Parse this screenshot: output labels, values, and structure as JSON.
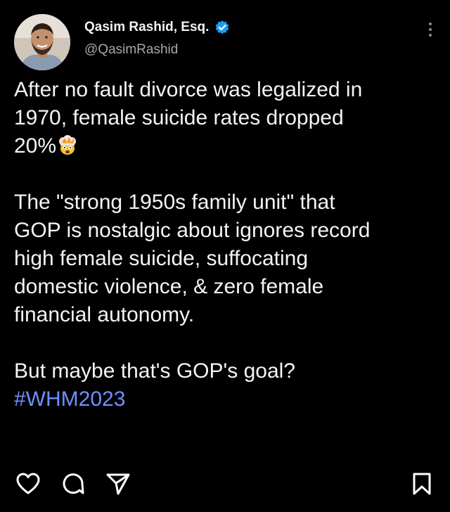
{
  "post": {
    "author_name": "Qasim Rashid, Esq.",
    "handle": "@QasimRashid",
    "paragraph1": {
      "line1": "After no fault divorce was legalized in",
      "line2": "1970, female suicide rates dropped",
      "line3": "20%"
    },
    "paragraph2": {
      "line1": "The \"strong 1950s family unit\" that",
      "line2": "GOP is nostalgic about ignores record",
      "line3": "high female suicide, suffocating",
      "line4": "domestic violence, & zero female",
      "line5": "financial autonomy."
    },
    "paragraph3": {
      "line1": "But maybe that's GOP's goal?",
      "hashtag": "#WHM2023"
    }
  },
  "icons": {
    "verified": "verified-badge-icon",
    "more": "more-options-icon",
    "emoji": "exploding-head-emoji",
    "like": "heart-icon",
    "reply": "comment-icon",
    "share": "send-icon",
    "save": "bookmark-icon"
  },
  "colors": {
    "background": "#000000",
    "text": "#f4f4f4",
    "handle": "#a8a8a8",
    "hashtag": "#6f8fff",
    "verified": "#1d9bf0"
  }
}
